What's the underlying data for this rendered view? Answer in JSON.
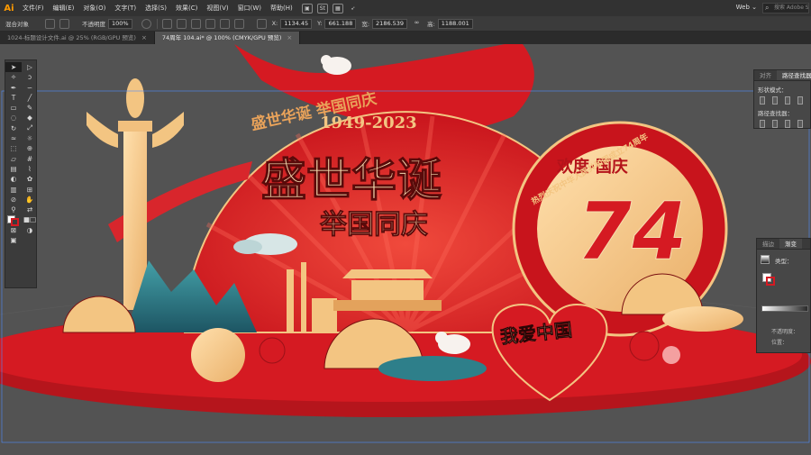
{
  "app": {
    "logo": "Ai"
  },
  "menubar": {
    "items": [
      "文件(F)",
      "编辑(E)",
      "对象(O)",
      "文字(T)",
      "选择(S)",
      "效果(C)",
      "视图(V)",
      "窗口(W)",
      "帮助(H)"
    ],
    "icons": [
      "bridge-icon",
      "stock-icon",
      "arrange-icon",
      "brush-icon"
    ],
    "workspace": "Web ⌄",
    "search_placeholder": "搜索 Adobe Stock"
  },
  "controlbar": {
    "selection_label": "混合对象",
    "opacity_label": "不透明度",
    "opacity_value": "100%",
    "x_label": "X:",
    "x_value": "1134.45",
    "y_label": "Y:",
    "y_value": "661.188",
    "w_label": "宽:",
    "w_value": "2186.539",
    "h_label": "高:",
    "h_value": "1188.001"
  },
  "tabs": [
    {
      "label": "1024-标题设计文件.ai @ 25% (RGB/GPU 预览)",
      "close": "×"
    },
    {
      "label": "74周年 104.ai* @ 100% (CMYK/GPU 预览)",
      "close": "×"
    }
  ],
  "artwork": {
    "headline": "盛世华诞",
    "subheadline": "举国同庆",
    "years": "1949-2023",
    "arc_text": "盛世华诞 举国同庆",
    "medallion_text": "欢度·国庆",
    "number": "74",
    "ring_text": "热烈庆祝中华人民共和国成立74周年",
    "heart_text": "我爱中国"
  },
  "colors": {
    "red": "#d51a22",
    "dark_red": "#9b1218",
    "gold": "#f3c582",
    "teal": "#2e7f8a",
    "canvas": "#535353",
    "ui_dark": "#323232"
  },
  "panels": {
    "pathfinder": {
      "tabs": [
        "对齐",
        "路径查找器"
      ],
      "shape_modes_label": "形状模式：",
      "pathfinders_label": "路径查找器："
    },
    "appearance": {
      "tabs": [
        "描边",
        "渐变"
      ],
      "type_label": "类型：",
      "opacity_label": "不透明度：",
      "position_label": "位置："
    }
  },
  "toolbox": {
    "tools": [
      "selection-tool",
      "direct-selection-tool",
      "magic-wand-tool",
      "lasso-tool",
      "pen-tool",
      "curvature-tool",
      "type-tool",
      "line-tool",
      "rectangle-tool",
      "paintbrush-tool",
      "shaper-tool",
      "eraser-tool",
      "rotate-tool",
      "scale-tool",
      "width-tool",
      "warp-tool",
      "free-transform-tool",
      "shape-builder-tool",
      "perspective-tool",
      "mesh-tool",
      "gradient-tool",
      "eyedropper-tool",
      "blend-tool",
      "symbol-tool",
      "graph-tool",
      "artboard-tool",
      "slice-tool",
      "hand-tool",
      "zoom-tool"
    ]
  }
}
